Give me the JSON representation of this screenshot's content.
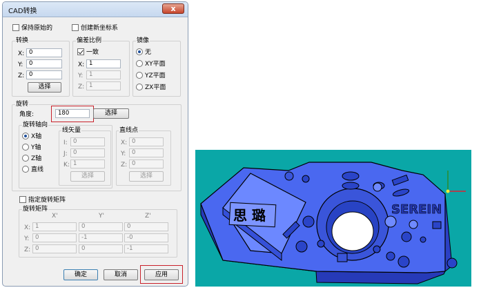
{
  "dialog": {
    "title": "CAD转换",
    "close_glyph": "x",
    "keep_original": "保持原始的",
    "create_new_cs": "创建新坐标系",
    "convert": {
      "title": "转换",
      "x_label": "X:",
      "x": "0",
      "y_label": "Y:",
      "y": "0",
      "z_label": "Z:",
      "z": "0",
      "select": "选择"
    },
    "scale": {
      "title": "偏差比例",
      "uniform": "一致",
      "x_label": "X:",
      "x": "1",
      "y_label": "Y:",
      "y": "1",
      "z_label": "Z:",
      "z": "1"
    },
    "mirror": {
      "title": "镜像",
      "none": "无",
      "xy": "XY平面",
      "yz": "YZ平面",
      "zx": "ZX平面"
    },
    "rotate": {
      "title": "旋转",
      "angle_label": "角度:",
      "angle": "180",
      "select": "选择",
      "axis_group": "旋转轴向",
      "axis_x": "X轴",
      "axis_y": "Y轴",
      "axis_z": "Z轴",
      "axis_line": "直线",
      "vector": {
        "title": "线矢量",
        "i_label": "I:",
        "i": "0",
        "j_label": "J:",
        "j": "0",
        "k_label": "K:",
        "k": "1",
        "select": "选择"
      },
      "point": {
        "title": "直线点",
        "x_label": "X:",
        "x": "0",
        "y_label": "Y:",
        "y": "0",
        "z_label": "Z:",
        "z": "0",
        "select": "选择"
      }
    },
    "matrix": {
      "checkbox": "指定旋转矩阵",
      "title": "旋转矩阵",
      "col_x": "X'",
      "col_y": "Y'",
      "col_z": "Z'",
      "row_x": "X:",
      "row_y": "Y:",
      "row_z": "Z:",
      "values": [
        [
          "1",
          "0",
          "0"
        ],
        [
          "0",
          "-1",
          "-0"
        ],
        [
          "0",
          "0",
          "-1"
        ]
      ]
    },
    "ok": "确定",
    "cancel": "取消",
    "apply": "应用"
  },
  "viewport": {
    "engraving_cn": "思 璐",
    "engraving_en": "SEREIN",
    "background_color": "#0aa7a7",
    "part_color": "#4a68f0"
  }
}
